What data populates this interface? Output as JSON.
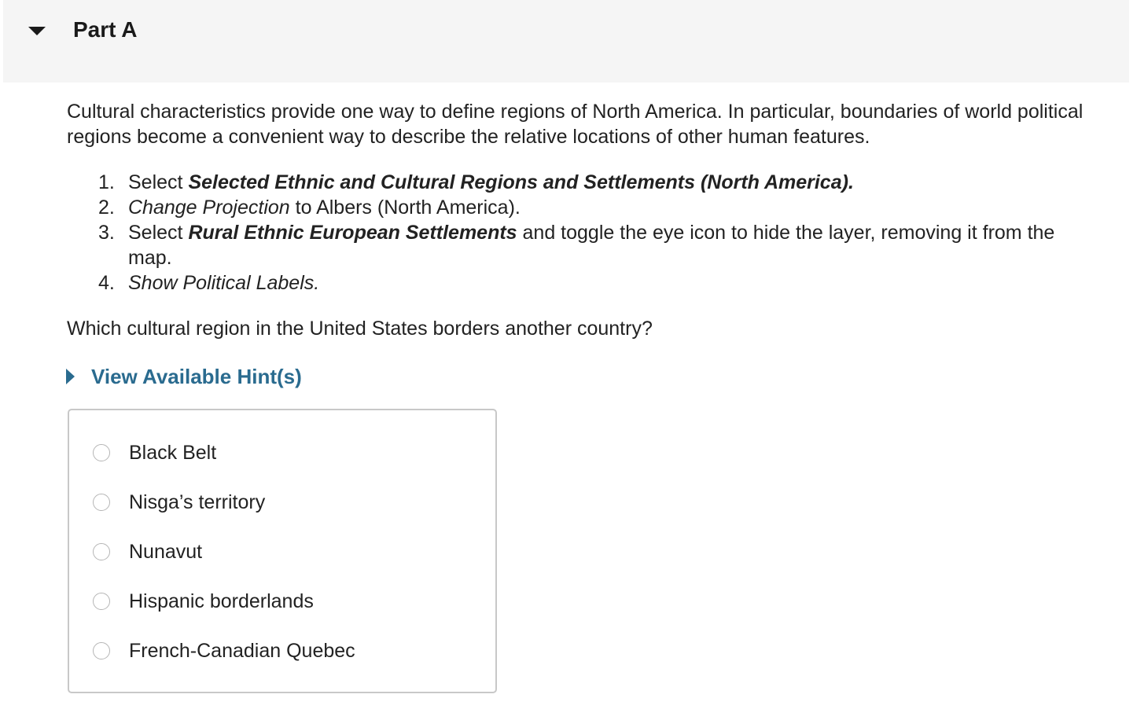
{
  "part": {
    "title": "Part A"
  },
  "intro": "Cultural characteristics provide one way to define regions of North America. In particular, boundaries of world political regions become a convenient way to describe the relative locations of other human features.",
  "steps": [
    {
      "num": "1.",
      "pre": "Select ",
      "emph": "Selected Ethnic and Cultural Regions and Settlements (North America).",
      "post": ""
    },
    {
      "num": "2.",
      "pre": "",
      "emph": "Change Projection",
      "post": " to Albers (North America)."
    },
    {
      "num": "3.",
      "pre": "Select ",
      "emph": "Rural Ethnic European Settlements",
      "post": " and toggle the eye icon to hide the layer, removing it from the map."
    },
    {
      "num": "4.",
      "pre": "",
      "emph": "Show Political Labels.",
      "post": ""
    }
  ],
  "question": "Which cultural region in the United States borders another country?",
  "hint": {
    "label": "View Available Hint(s)"
  },
  "choices": [
    "Black Belt",
    "Nisga’s territory",
    "Nunavut",
    "Hispanic borderlands",
    "French-Canadian Quebec"
  ],
  "colors": {
    "header_bg": "#f5f5f5",
    "link": "#2a6b8f",
    "text": "#222222",
    "border": "#c8c8c8"
  },
  "icons": {
    "part_toggle": "caret-down-icon",
    "hint_toggle": "caret-right-icon"
  }
}
